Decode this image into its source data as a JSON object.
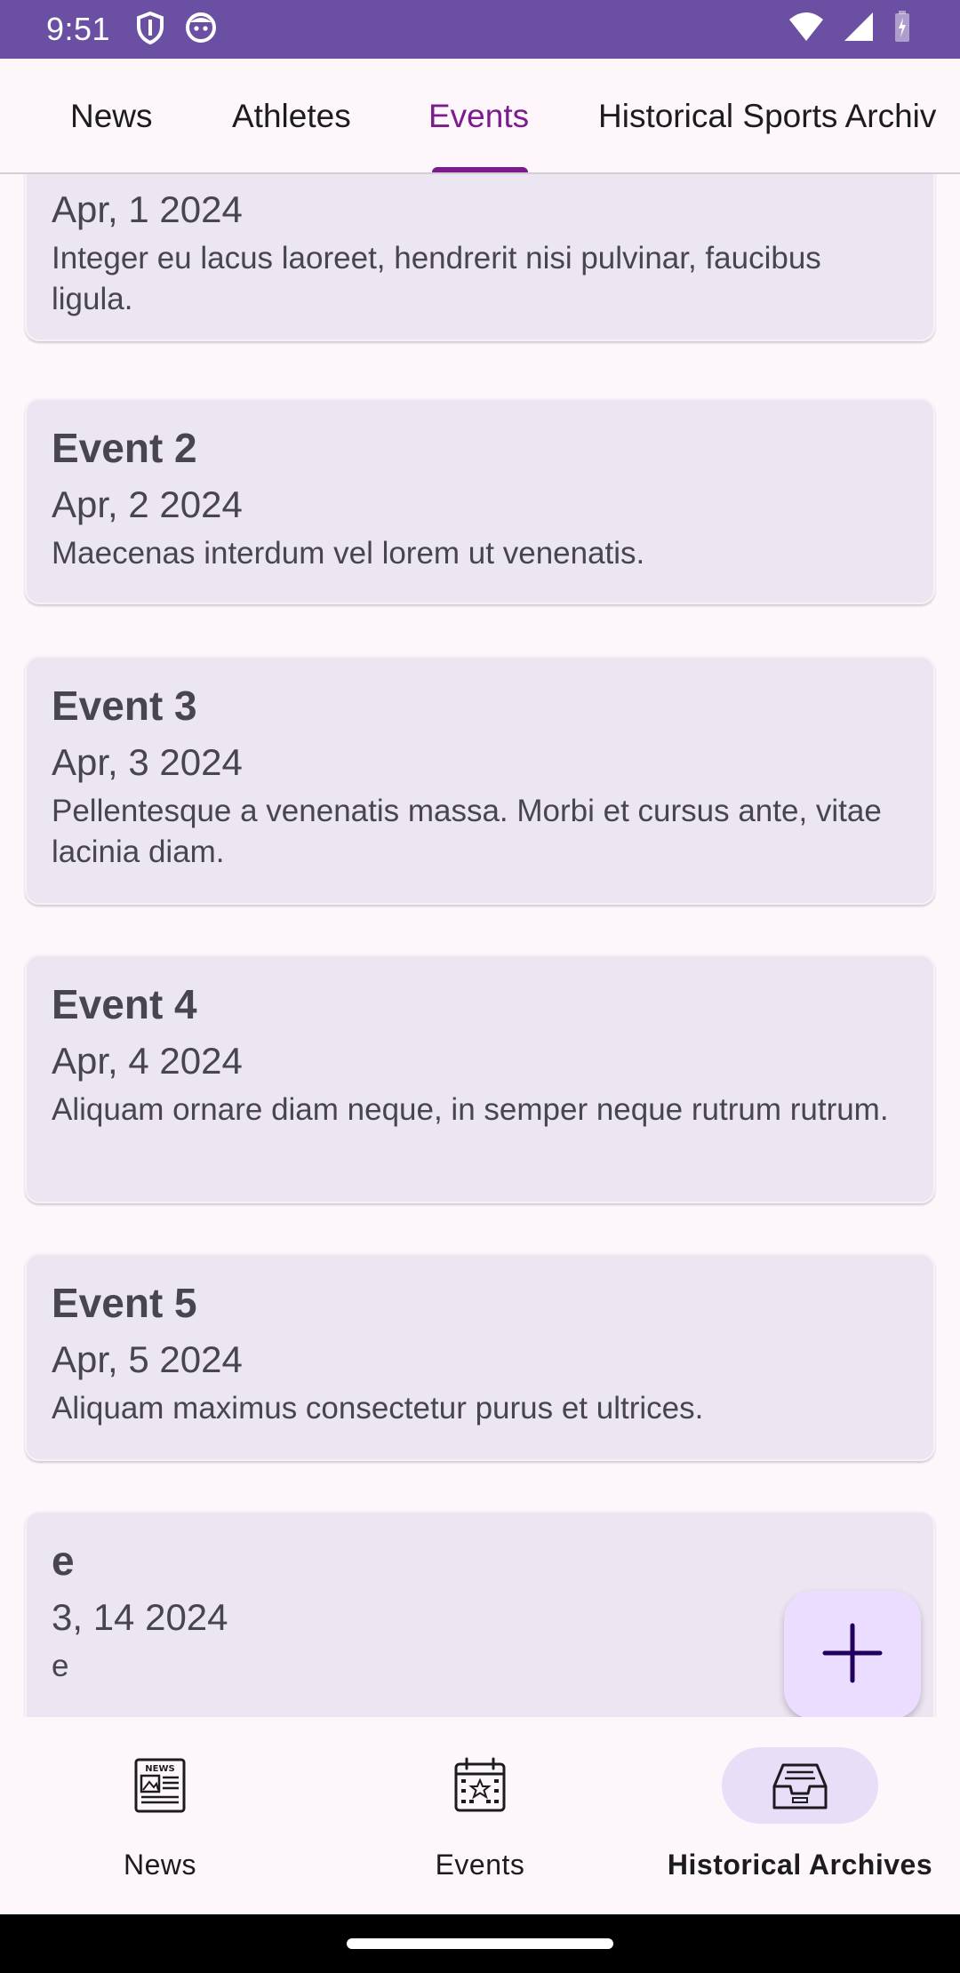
{
  "status_bar": {
    "time": "9:51"
  },
  "top_tabs": [
    {
      "label": "News"
    },
    {
      "label": "Athletes"
    },
    {
      "label": "Events"
    },
    {
      "label": "Historical Sports Archiv"
    }
  ],
  "events": [
    {
      "title": "",
      "date": "Apr, 1 2024",
      "description": " Integer eu lacus laoreet, hendrerit nisi pulvinar, faucibus ligula."
    },
    {
      "title": "Event 2",
      "date": "Apr, 2 2024",
      "description": "Maecenas interdum vel lorem ut venenatis."
    },
    {
      "title": "Event 3",
      "date": "Apr, 3 2024",
      "description": "Pellentesque a venenatis massa. Morbi et cursus ante, vitae lacinia diam."
    },
    {
      "title": "Event 4",
      "date": "Apr, 4 2024",
      "description": "Aliquam ornare diam neque, in semper neque rutrum rutrum."
    },
    {
      "title": "Event 5",
      "date": "Apr, 5 2024",
      "description": "Aliquam maximus consectetur purus et ultrices."
    },
    {
      "title": "e",
      "date": "3, 14 2024",
      "description": "e"
    }
  ],
  "bottom_nav": [
    {
      "label": "News",
      "icon": "newspaper-icon"
    },
    {
      "label": "Events",
      "icon": "calendar-icon"
    },
    {
      "label": "Historical Archives",
      "icon": "archive-box-icon"
    }
  ],
  "colors": {
    "status_bar": "#6a4fa3",
    "accent": "#7c1c8c",
    "card_bg": "#ece6f2",
    "fab_bg": "#eaddff",
    "nav_pill": "#e8def8"
  }
}
